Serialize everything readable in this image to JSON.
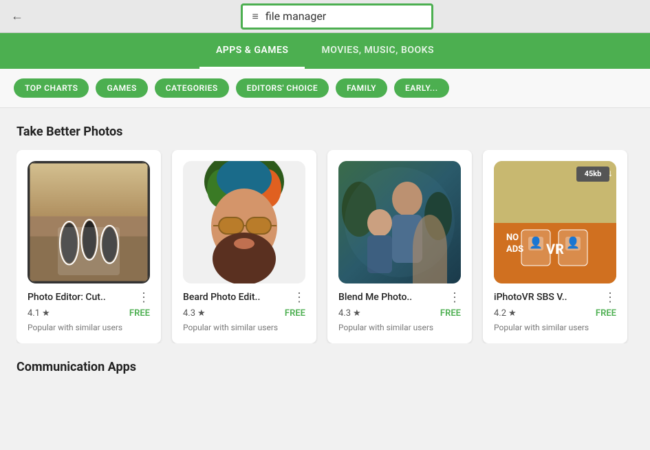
{
  "browser": {
    "back_icon": "←",
    "search_hamburger": "≡",
    "search_text": "file manager"
  },
  "header": {
    "tabs": [
      {
        "id": "apps-games",
        "label": "APPS & GAMES",
        "active": true
      },
      {
        "id": "movies-music",
        "label": "MOVIES, MUSIC, BOOKS",
        "active": false
      }
    ]
  },
  "chips": [
    {
      "id": "top-charts",
      "label": "TOP CHARTS"
    },
    {
      "id": "games",
      "label": "GAMES"
    },
    {
      "id": "categories",
      "label": "CATEGORIES"
    },
    {
      "id": "editors-choice",
      "label": "EDITORS' CHOICE"
    },
    {
      "id": "family",
      "label": "FAMILY"
    },
    {
      "id": "early-access",
      "label": "EARLY..."
    }
  ],
  "sections": [
    {
      "id": "take-better-photos",
      "title": "Take Better Photos",
      "apps": [
        {
          "id": "photo-editor",
          "name": "Photo Editor: Cut..",
          "rating": "4.1",
          "price": "FREE",
          "popular": "Popular with similar users"
        },
        {
          "id": "beard-photo",
          "name": "Beard Photo Edit..",
          "rating": "4.3",
          "price": "FREE",
          "popular": "Popular with similar users"
        },
        {
          "id": "blend-me",
          "name": "Blend Me Photo..",
          "rating": "4.3",
          "price": "FREE",
          "popular": "Popular with similar users"
        },
        {
          "id": "iphoto-vr",
          "name": "iPhotoVR SBS V..",
          "rating": "4.2",
          "price": "FREE",
          "popular": "Popular with similar users",
          "badge": "45kb"
        }
      ]
    },
    {
      "id": "communication-apps",
      "title": "Communication Apps"
    }
  ],
  "icons": {
    "star": "★",
    "more": "⋮",
    "hamburger": "≡",
    "back": "←",
    "download": "↓"
  }
}
